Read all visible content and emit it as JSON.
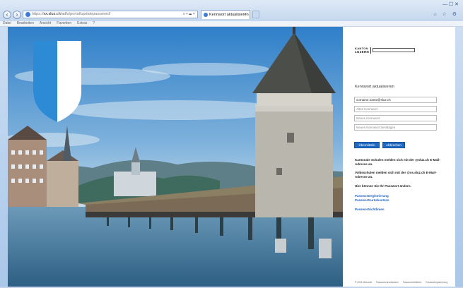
{
  "browser": {
    "url_prefix": "https://",
    "url_domain": "xx.sluz.ch",
    "url_path": "/adfs/portal/updatepassword/",
    "address_tools": "⌕ ▾ ☰ ×",
    "tab_title": "Kennwort aktualisieren",
    "tab_close": "×",
    "menu": [
      "Datei",
      "Bearbeiten",
      "Ansicht",
      "Favoriten",
      "Extras",
      "?"
    ],
    "right_icons": "⌂ ☆ ⚙",
    "window_controls": "— ☐ ✕"
  },
  "logo": {
    "line1": "KANTON",
    "line2": "LUZERN"
  },
  "form": {
    "title": "Kennwort aktualisieren",
    "username_value": "vorname.name@sluz.ch",
    "old_password_placeholder": "Altes Kennwort",
    "new_password_placeholder": "Neues Kennwort",
    "confirm_password_placeholder": "Neues Kennwort bestätigen",
    "submit_label": "Übermitteln",
    "cancel_label": "Abbrechen"
  },
  "notes": {
    "schools": "Kantonale Schulen melden sich mit der @sluz.ch E-Mail-Adresse an.",
    "primary_schools": "Volksschulen melden sich mit der @vs.sluz.ch E-Mail-Adresse an.",
    "change_here": "Hier können Sie Ihr Passwort ändern."
  },
  "links": {
    "registration": "Passwortregistrierung",
    "reset": "Passwortzurücksetzen",
    "guidelines": "Passwortrichtlinien"
  },
  "footer": {
    "copyright": "© 2013 Microsoft",
    "items": [
      "Passwortzurücksetzen",
      "Passwortrichtlinien",
      "Passwortregistrierung"
    ]
  },
  "colors": {
    "accent": "#1f69c2",
    "link": "#1f5fbf",
    "crest_blue": "#2d8bd6"
  }
}
